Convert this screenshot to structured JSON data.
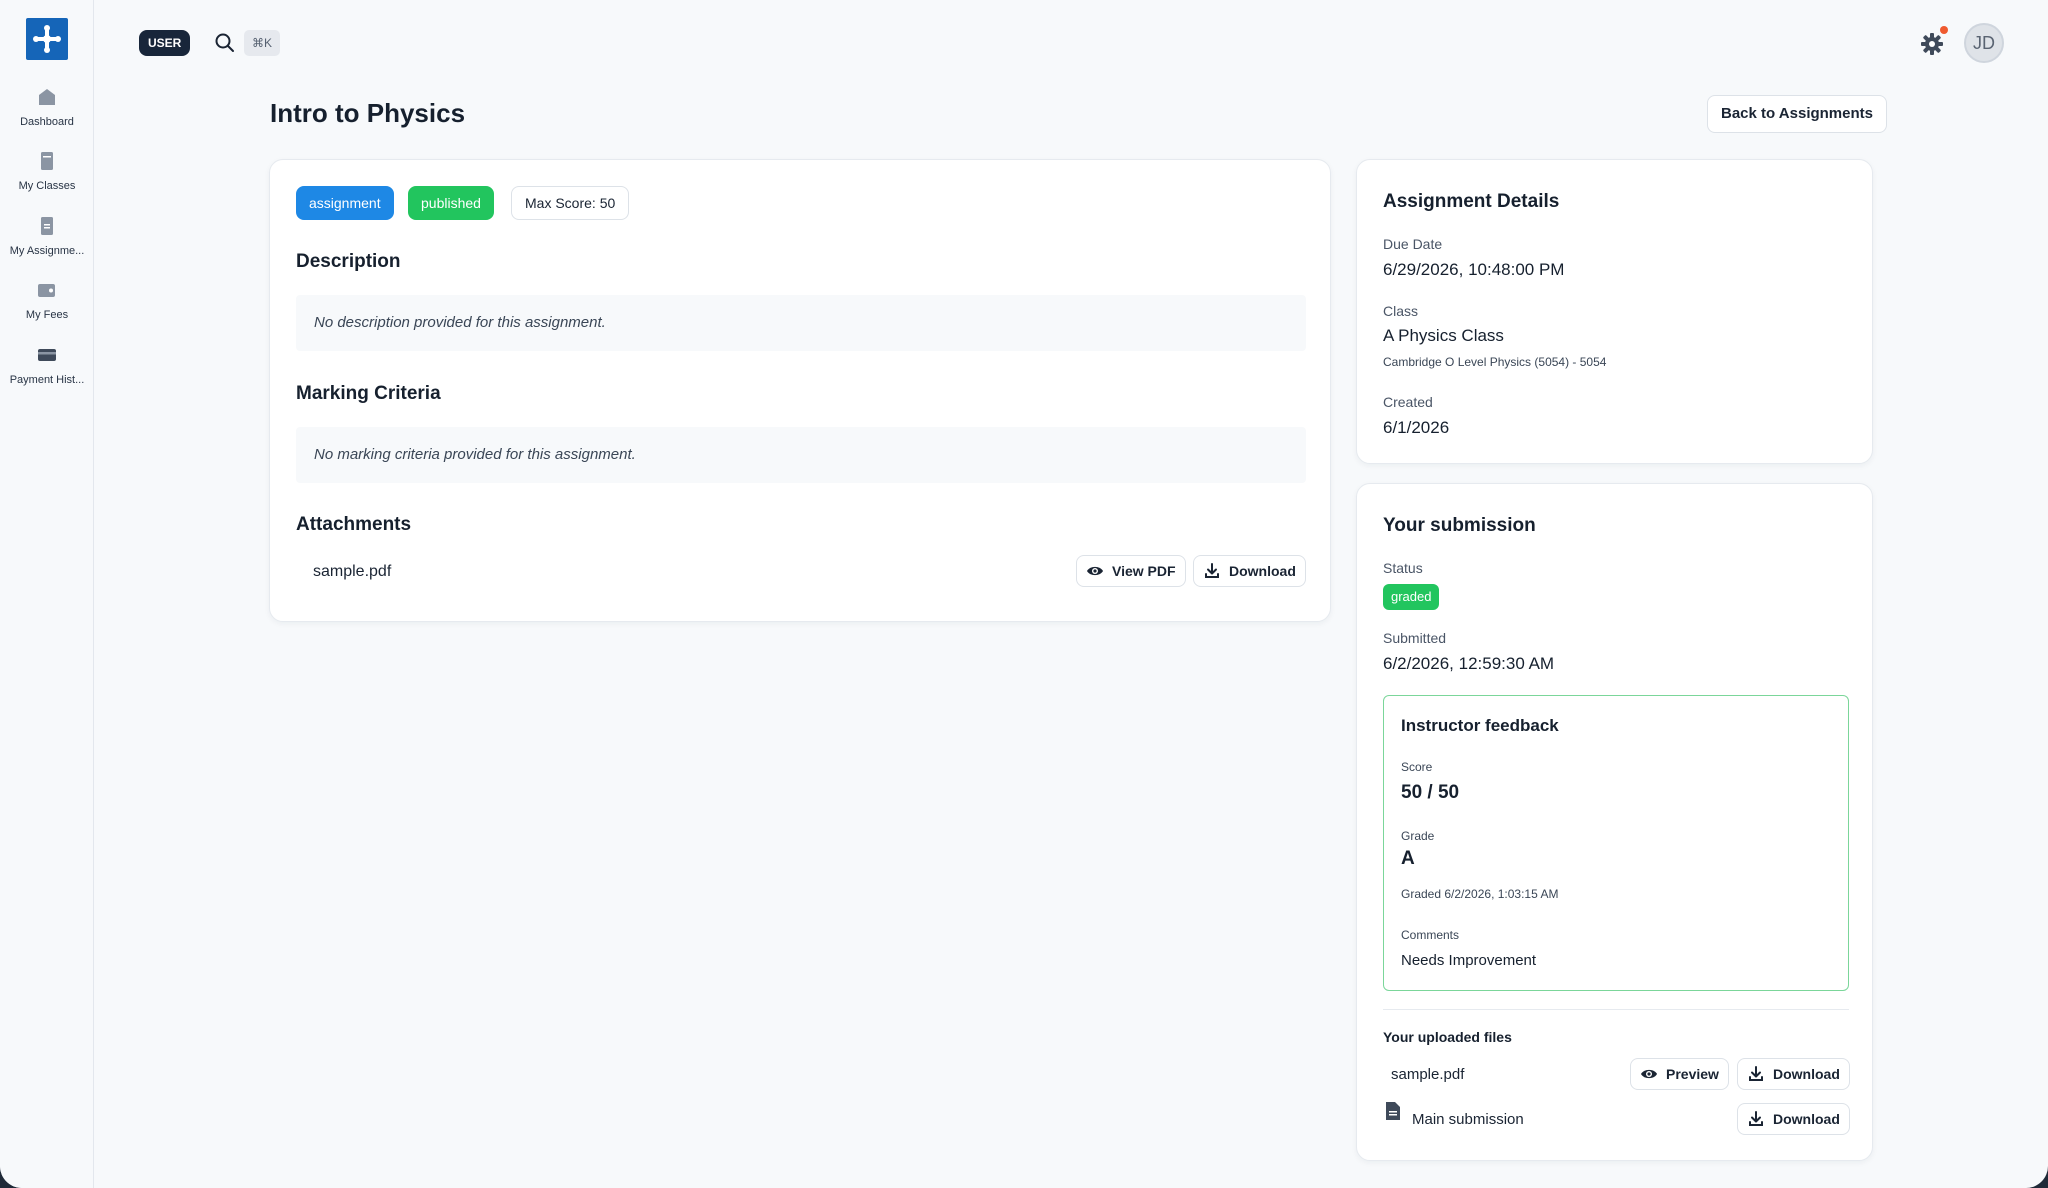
{
  "sidebar": {
    "items": [
      {
        "label": "Dashboard",
        "icon": "home-icon"
      },
      {
        "label": "My Classes",
        "icon": "book-icon"
      },
      {
        "label": "My Assignme...",
        "icon": "assignment-icon"
      },
      {
        "label": "My Fees",
        "icon": "wallet-icon"
      },
      {
        "label": "Payment Hist...",
        "icon": "credit-card-icon"
      }
    ]
  },
  "topbar": {
    "role": "USER",
    "shortcut": "⌘K",
    "avatar_initials": "JD"
  },
  "page": {
    "title": "Intro to Physics",
    "back_label": "Back to Assignments"
  },
  "assignment": {
    "type_tag": "assignment",
    "status_tag": "published",
    "max_score": "Max Score: 50",
    "description_heading": "Description",
    "description_empty": "No description provided for this assignment.",
    "criteria_heading": "Marking Criteria",
    "criteria_empty": "No marking criteria provided for this assignment.",
    "attachments_heading": "Attachments",
    "attachment_name": "sample.pdf",
    "view_pdf_label": "View PDF",
    "download_label": "Download"
  },
  "details": {
    "title": "Assignment Details",
    "due_label": "Due Date",
    "due_value": "6/29/2026, 10:48:00 PM",
    "class_label": "Class",
    "class_value": "A Physics Class",
    "class_sub": "Cambridge O Level Physics (5054) - 5054",
    "created_label": "Created",
    "created_value": "6/1/2026"
  },
  "submission": {
    "title": "Your submission",
    "status_label": "Status",
    "status_value": "graded",
    "submitted_label": "Submitted",
    "submitted_value": "6/2/2026, 12:59:30 AM",
    "feedback": {
      "title": "Instructor feedback",
      "score_label": "Score",
      "score_value": "50 / 50",
      "grade_label": "Grade",
      "grade_value": "A",
      "graded_at": "Graded 6/2/2026, 1:03:15 AM",
      "comments_label": "Comments",
      "comments_value": "Needs Improvement"
    },
    "uploaded_heading": "Your uploaded files",
    "file1_name": "sample.pdf",
    "preview_label": "Preview",
    "download_label": "Download",
    "file2_name": "Main submission"
  },
  "colors": {
    "primary": "#1e88e5",
    "success": "#22c55e",
    "logo": "#1565b8",
    "notification": "#ef5a2f"
  }
}
